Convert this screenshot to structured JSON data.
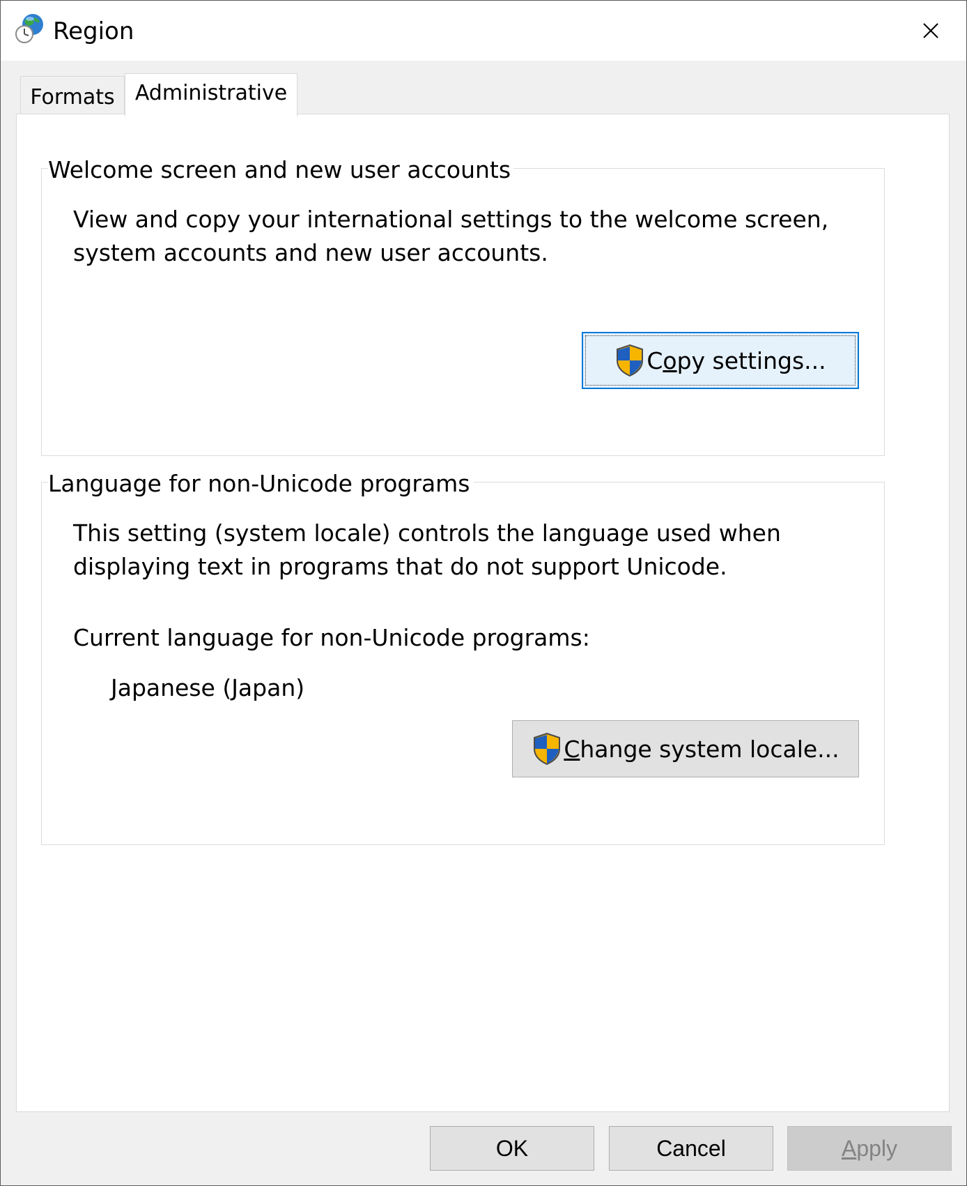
{
  "window": {
    "title": "Region",
    "close_glyph": "✕"
  },
  "tabs": [
    {
      "label": "Formats",
      "selected": false
    },
    {
      "label": "Administrative",
      "selected": true
    }
  ],
  "welcome_group": {
    "title": "Welcome screen and new user accounts",
    "description": "View and copy your international settings to the welcome screen, system accounts and new user accounts.",
    "copy_button": {
      "mnemonic_pre": "C",
      "mnemonic": "o",
      "mnemonic_post": "py settings...",
      "icon": "uac-shield-icon"
    }
  },
  "locale_group": {
    "title": "Language for non-Unicode programs",
    "description": "This setting (system locale) controls the language used when displaying text in programs that do not support Unicode.",
    "current_label": "Current language for non-Unicode programs:",
    "current_value": "Japanese (Japan)",
    "change_button": {
      "mnemonic": "C",
      "rest": "hange system locale...",
      "icon": "uac-shield-icon"
    }
  },
  "footer": {
    "ok_label": "OK",
    "cancel_label": "Cancel",
    "apply_mnemonic": "A",
    "apply_rest": "pply",
    "apply_enabled": false
  },
  "colors": {
    "focus_border": "#0078d7",
    "disabled_text": "#838383",
    "shield_blue": "#1f5fbf",
    "shield_yellow": "#f7b500"
  }
}
